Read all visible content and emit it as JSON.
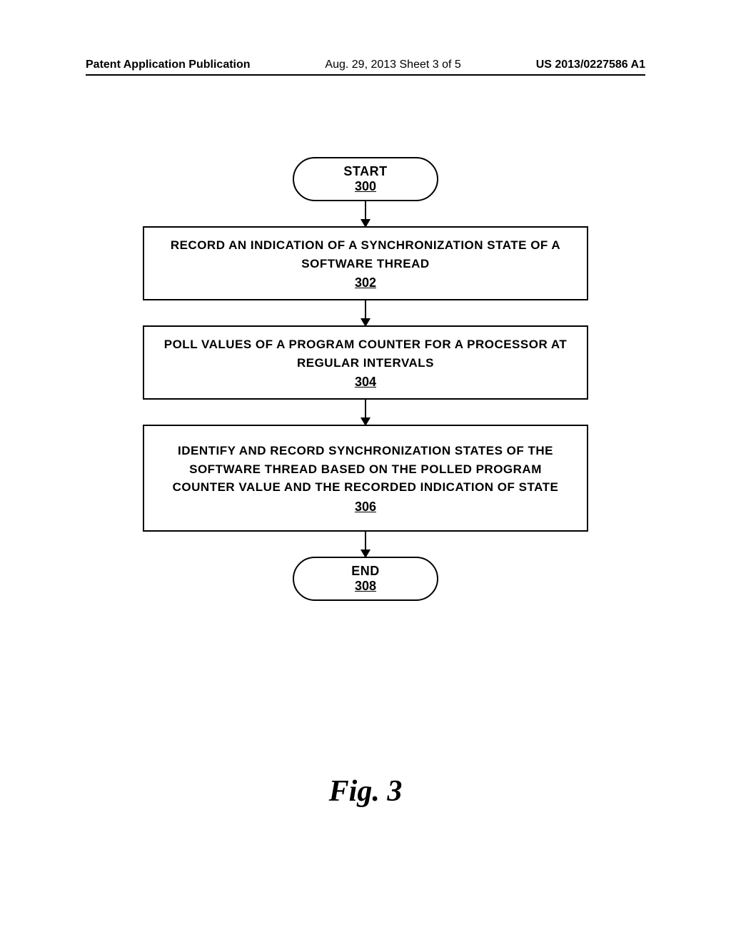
{
  "header": {
    "left": "Patent Application Publication",
    "center": "Aug. 29, 2013  Sheet 3 of 5",
    "right": "US 2013/0227586 A1"
  },
  "flowchart": {
    "start": {
      "label": "START",
      "num": "300"
    },
    "step1": {
      "text": "RECORD AN INDICATION OF A SYNCHRONIZATION STATE OF A SOFTWARE THREAD",
      "num": "302"
    },
    "step2": {
      "text": "POLL VALUES OF A PROGRAM COUNTER FOR A PROCESSOR AT REGULAR INTERVALS",
      "num": "304"
    },
    "step3": {
      "text": "IDENTIFY AND RECORD SYNCHRONIZATION STATES OF THE SOFTWARE THREAD BASED ON THE POLLED PROGRAM COUNTER VALUE AND THE RECORDED INDICATION OF STATE",
      "num": "306"
    },
    "end": {
      "label": "END",
      "num": "308"
    }
  },
  "figure_label": "Fig. 3"
}
